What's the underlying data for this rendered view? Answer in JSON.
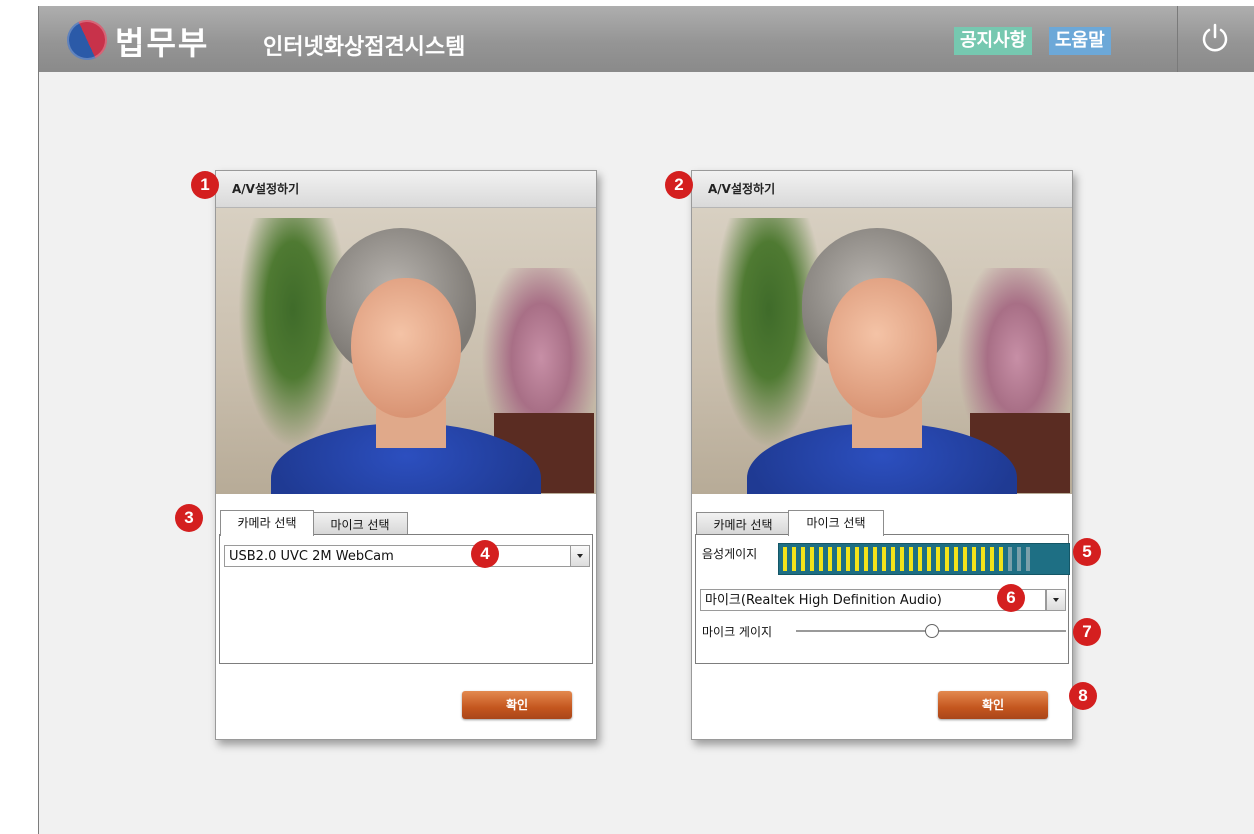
{
  "header": {
    "ministry": "법무부",
    "system_title": "인터넷화상접견시스템",
    "notice_label": "공지사항",
    "help_label": "도움말"
  },
  "panels": [
    {
      "title": "A/V설정하기",
      "tabs": [
        "카메라 선택",
        "마이크 선택"
      ],
      "active_tab": "카메라 선택",
      "camera_select_value": "USB2.0 UVC 2M WebCam",
      "confirm_label": "확인"
    },
    {
      "title": "A/V설정하기",
      "tabs": [
        "카메라 선택",
        "마이크 선택"
      ],
      "active_tab": "마이크 선택",
      "voice_gauge_label": "음성게이지",
      "voice_gauge_level": 0.9,
      "mic_select_value": "마이크(Realtek High Definition Audio)",
      "mic_gauge_label": "마이크 게이지",
      "mic_gauge_value": 0.5,
      "confirm_label": "확인"
    }
  ],
  "markers": [
    "1",
    "2",
    "3",
    "4",
    "5",
    "6",
    "7",
    "8"
  ],
  "colors": {
    "marker": "#d41f1f",
    "confirm_button": "#c4561e",
    "notice_button": "#76c8b0",
    "help_button": "#6ca8d8",
    "meter_bg": "#1e6f84",
    "meter_bar": "#f2e21a"
  },
  "icons": [
    "ministry-logo-icon",
    "power-icon",
    "dropdown-arrow-icon"
  ]
}
